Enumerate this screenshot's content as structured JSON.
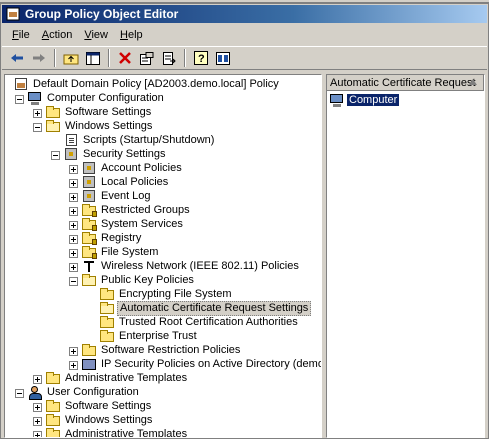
{
  "window": {
    "title": "Group Policy Object Editor"
  },
  "menu": [
    {
      "label": "File",
      "mnemonic": "F",
      "rest": "ile"
    },
    {
      "label": "Action",
      "mnemonic": "A",
      "rest": "ction"
    },
    {
      "label": "View",
      "mnemonic": "V",
      "rest": "iew"
    },
    {
      "label": "Help",
      "mnemonic": "H",
      "rest": "elp"
    }
  ],
  "toolbar": {
    "buttons": [
      "back-arrow-icon",
      "forward-arrow-icon",
      "up-folder-icon",
      "show-hide-tree-icon",
      "delete-icon",
      "properties-icon",
      "export-list-icon",
      "help-icon",
      "console-icon"
    ]
  },
  "tree": {
    "items": [
      {
        "label": "Default Domain Policy [AD2003.demo.local] Policy",
        "icon": "gpo-icon"
      },
      {
        "label": "Computer Configuration",
        "icon": "computer-icon"
      },
      {
        "label": "Software Settings",
        "icon": "folder-icon"
      },
      {
        "label": "Windows Settings",
        "icon": "folder-icon"
      },
      {
        "label": "Scripts (Startup/Shutdown)",
        "icon": "script-icon"
      },
      {
        "label": "Security Settings",
        "icon": "security-settings-icon"
      },
      {
        "label": "Account Policies",
        "icon": "account-policies-icon"
      },
      {
        "label": "Local Policies",
        "icon": "local-policies-icon"
      },
      {
        "label": "Event Log",
        "icon": "event-log-icon"
      },
      {
        "label": "Restricted Groups",
        "icon": "folder-lock-icon"
      },
      {
        "label": "System Services",
        "icon": "folder-lock-icon"
      },
      {
        "label": "Registry",
        "icon": "folder-lock-icon"
      },
      {
        "label": "File System",
        "icon": "folder-lock-icon"
      },
      {
        "label": "Wireless Network (IEEE 802.11) Policies",
        "icon": "antenna-icon"
      },
      {
        "label": "Public Key Policies",
        "icon": "folder-icon"
      },
      {
        "label": "Encrypting File System",
        "icon": "folder-icon"
      },
      {
        "label": "Automatic Certificate Request Settings",
        "icon": "folder-open-icon"
      },
      {
        "label": "Trusted Root Certification Authorities",
        "icon": "folder-icon"
      },
      {
        "label": "Enterprise Trust",
        "icon": "folder-icon"
      },
      {
        "label": "Software Restriction Policies",
        "icon": "folder-icon"
      },
      {
        "label": "IP Security Policies on Active Directory (demo.local)",
        "icon": "ipsec-icon"
      },
      {
        "label": "Administrative Templates",
        "icon": "folder-icon"
      },
      {
        "label": "User Configuration",
        "icon": "user-icon"
      },
      {
        "label": "Software Settings",
        "icon": "folder-icon"
      },
      {
        "label": "Windows Settings",
        "icon": "folder-icon"
      },
      {
        "label": "Administrative Templates",
        "icon": "folder-icon"
      }
    ]
  },
  "details": {
    "column_header": "Automatic Certificate Request",
    "rows": [
      {
        "label": "Computer"
      }
    ]
  }
}
